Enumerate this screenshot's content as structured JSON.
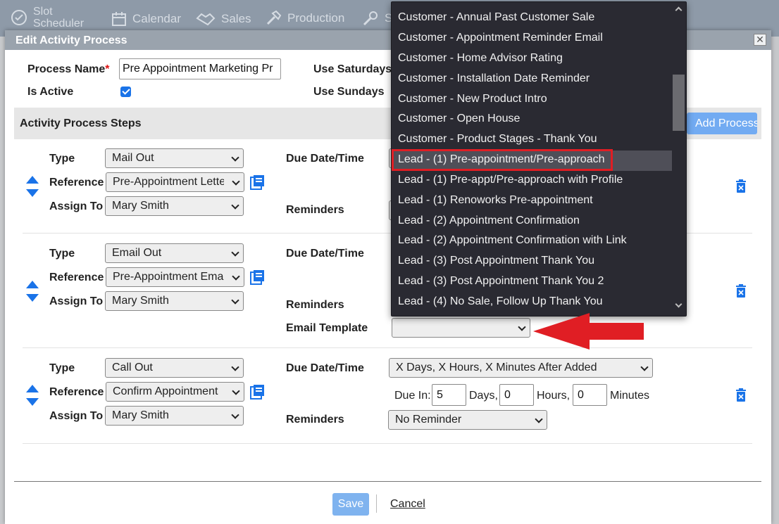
{
  "nav": {
    "items": [
      {
        "label": "Slot\nScheduler",
        "icon": "check-circle-icon"
      },
      {
        "label": "Calendar",
        "icon": "calendar-icon"
      },
      {
        "label": "Sales",
        "icon": "handshake-icon"
      },
      {
        "label": "Production",
        "icon": "hammer-icon"
      },
      {
        "label": "S",
        "icon": "wrench-icon"
      }
    ]
  },
  "modal": {
    "title": "Edit Activity Process",
    "close_glyph": "✕",
    "process_name_label": "Process Name",
    "required_mark": "*",
    "process_name_value": "Pre Appointment Marketing Pr",
    "is_active_label": "Is Active",
    "is_active_checked": true,
    "use_saturdays_label": "Use Saturdays",
    "use_sundays_label": "Use Sundays",
    "section_title": "Activity Process Steps",
    "add_step_label": "Add Process Step",
    "steps": [
      {
        "type_label": "Type",
        "type_value": "Mail Out",
        "reference_label": "Reference",
        "reference_value": "Pre-Appointment Lette",
        "assign_label": "Assign To",
        "assign_value": "Mary Smith",
        "due_label": "Due Date/Time",
        "reminders_label": "Reminders"
      },
      {
        "type_label": "Type",
        "type_value": "Email Out",
        "reference_label": "Reference",
        "reference_value": "Pre-Appointment Emai",
        "assign_label": "Assign To",
        "assign_value": "Mary Smith",
        "due_label": "Due Date/Time",
        "reminders_label": "Reminders",
        "email_template_label": "Email Template",
        "email_template_value": ""
      },
      {
        "type_label": "Type",
        "type_value": "Call Out",
        "reference_label": "Reference",
        "reference_value": "Confirm Appointment",
        "assign_label": "Assign To",
        "assign_value": "Mary Smith",
        "due_label": "Due Date/Time",
        "due_value": "X Days, X Hours, X Minutes After Added",
        "due_in_label": "Due In:",
        "days_value": "5",
        "days_label": "Days,",
        "hours_value": "0",
        "hours_label": "Hours,",
        "minutes_value": "0",
        "minutes_label": "Minutes",
        "reminders_label": "Reminders",
        "reminders_value": "No Reminder"
      }
    ],
    "save_label": "Save",
    "cancel_label": "Cancel"
  },
  "dropdown": {
    "options": [
      "Customer - Annual Past Customer Sale",
      "Customer - Appointment Reminder Email",
      "Customer - Home Advisor Rating",
      "Customer - Installation Date Reminder",
      "Customer - New Product Intro",
      "Customer - Open House",
      "Customer - Product Stages - Thank You",
      "Lead - (1) Pre-appointment/Pre-approach",
      "Lead - (1) Pre-appt/Pre-approach with Profile",
      "Lead - (1) Renoworks Pre-appointment",
      "Lead - (2) Appointment Confirmation",
      "Lead - (2) Appointment Confirmation with Link",
      "Lead - (3) Post Appointment Thank You",
      "Lead - (3) Post Appointment Thank You 2",
      "Lead - (4) No Sale, Follow Up Thank You"
    ],
    "selected": "Lead - (1) Pre-appointment/Pre-approach"
  },
  "colors": {
    "accent": "#1a73e8",
    "annotation_red": "#e01e24",
    "dropdown_bg": "#2a2a32"
  }
}
